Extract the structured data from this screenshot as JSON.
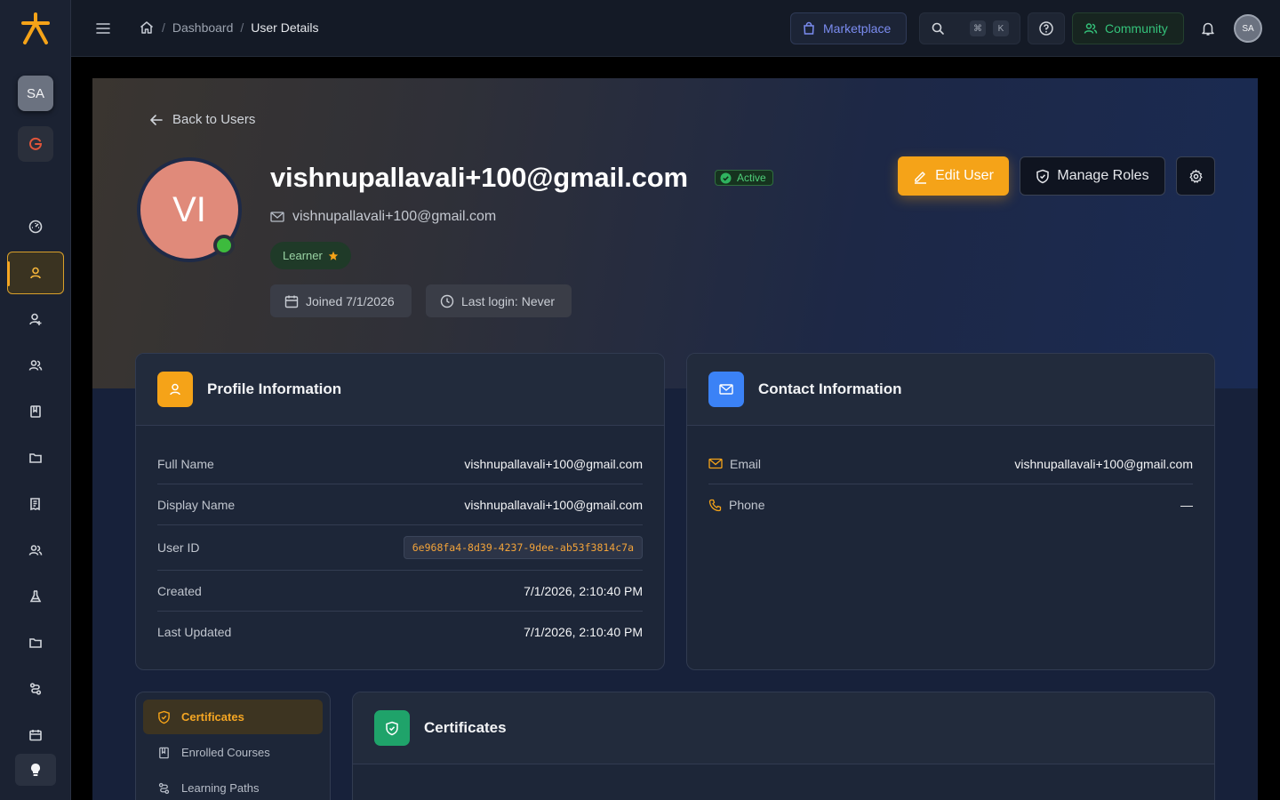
{
  "sidebar": {
    "avatar_initials": "SA",
    "items": [
      "dashboard-icon",
      "user-icon",
      "user-plus-icon",
      "users-icon",
      "book-icon",
      "folder-icon",
      "receipt-icon",
      "users-group-icon",
      "flask-icon",
      "folder-icon",
      "route-icon",
      "calendar-icon"
    ],
    "active_index": 1
  },
  "topbar": {
    "breadcrumb": [
      "Dashboard",
      "User Details"
    ],
    "separator": "/",
    "marketplace_label": "Marketplace",
    "search_kbd": [
      "⌘",
      "K"
    ],
    "community_label": "Community",
    "avatar_initials": "SA"
  },
  "hero": {
    "back_label": "Back to Users",
    "avatar_initials": "VI",
    "title": "vishnupallavali+100@gmail.com",
    "status": "Active",
    "email": "vishnupallavali+100@gmail.com",
    "role_badge": "Learner",
    "joined": "Joined 7/1/2026",
    "last_login": "Last login: Never",
    "edit_label": "Edit User",
    "roles_label": "Manage Roles"
  },
  "profile": {
    "title": "Profile Information",
    "rows": [
      {
        "label": "Full Name",
        "value": "vishnupallavali+100@gmail.com"
      },
      {
        "label": "Display Name",
        "value": "vishnupallavali+100@gmail.com"
      },
      {
        "label": "User ID",
        "value": "6e968fa4-8d39-4237-9dee-ab53f3814c7a"
      },
      {
        "label": "Created",
        "value": "7/1/2026, 2:10:40 PM"
      },
      {
        "label": "Last Updated",
        "value": "7/1/2026, 2:10:40 PM"
      }
    ]
  },
  "contact": {
    "title": "Contact Information",
    "rows": [
      {
        "label": "Email",
        "value": "vishnupallavali+100@gmail.com"
      },
      {
        "label": "Phone",
        "value": "—"
      }
    ]
  },
  "tabs": [
    "Certificates",
    "Enrolled Courses",
    "Learning Paths"
  ],
  "certificates": {
    "title": "Certificates"
  },
  "colors": {
    "accent": "#f5a318",
    "blue": "#3b82f6",
    "green": "#1fa36a",
    "active": "#4fcf7a"
  }
}
